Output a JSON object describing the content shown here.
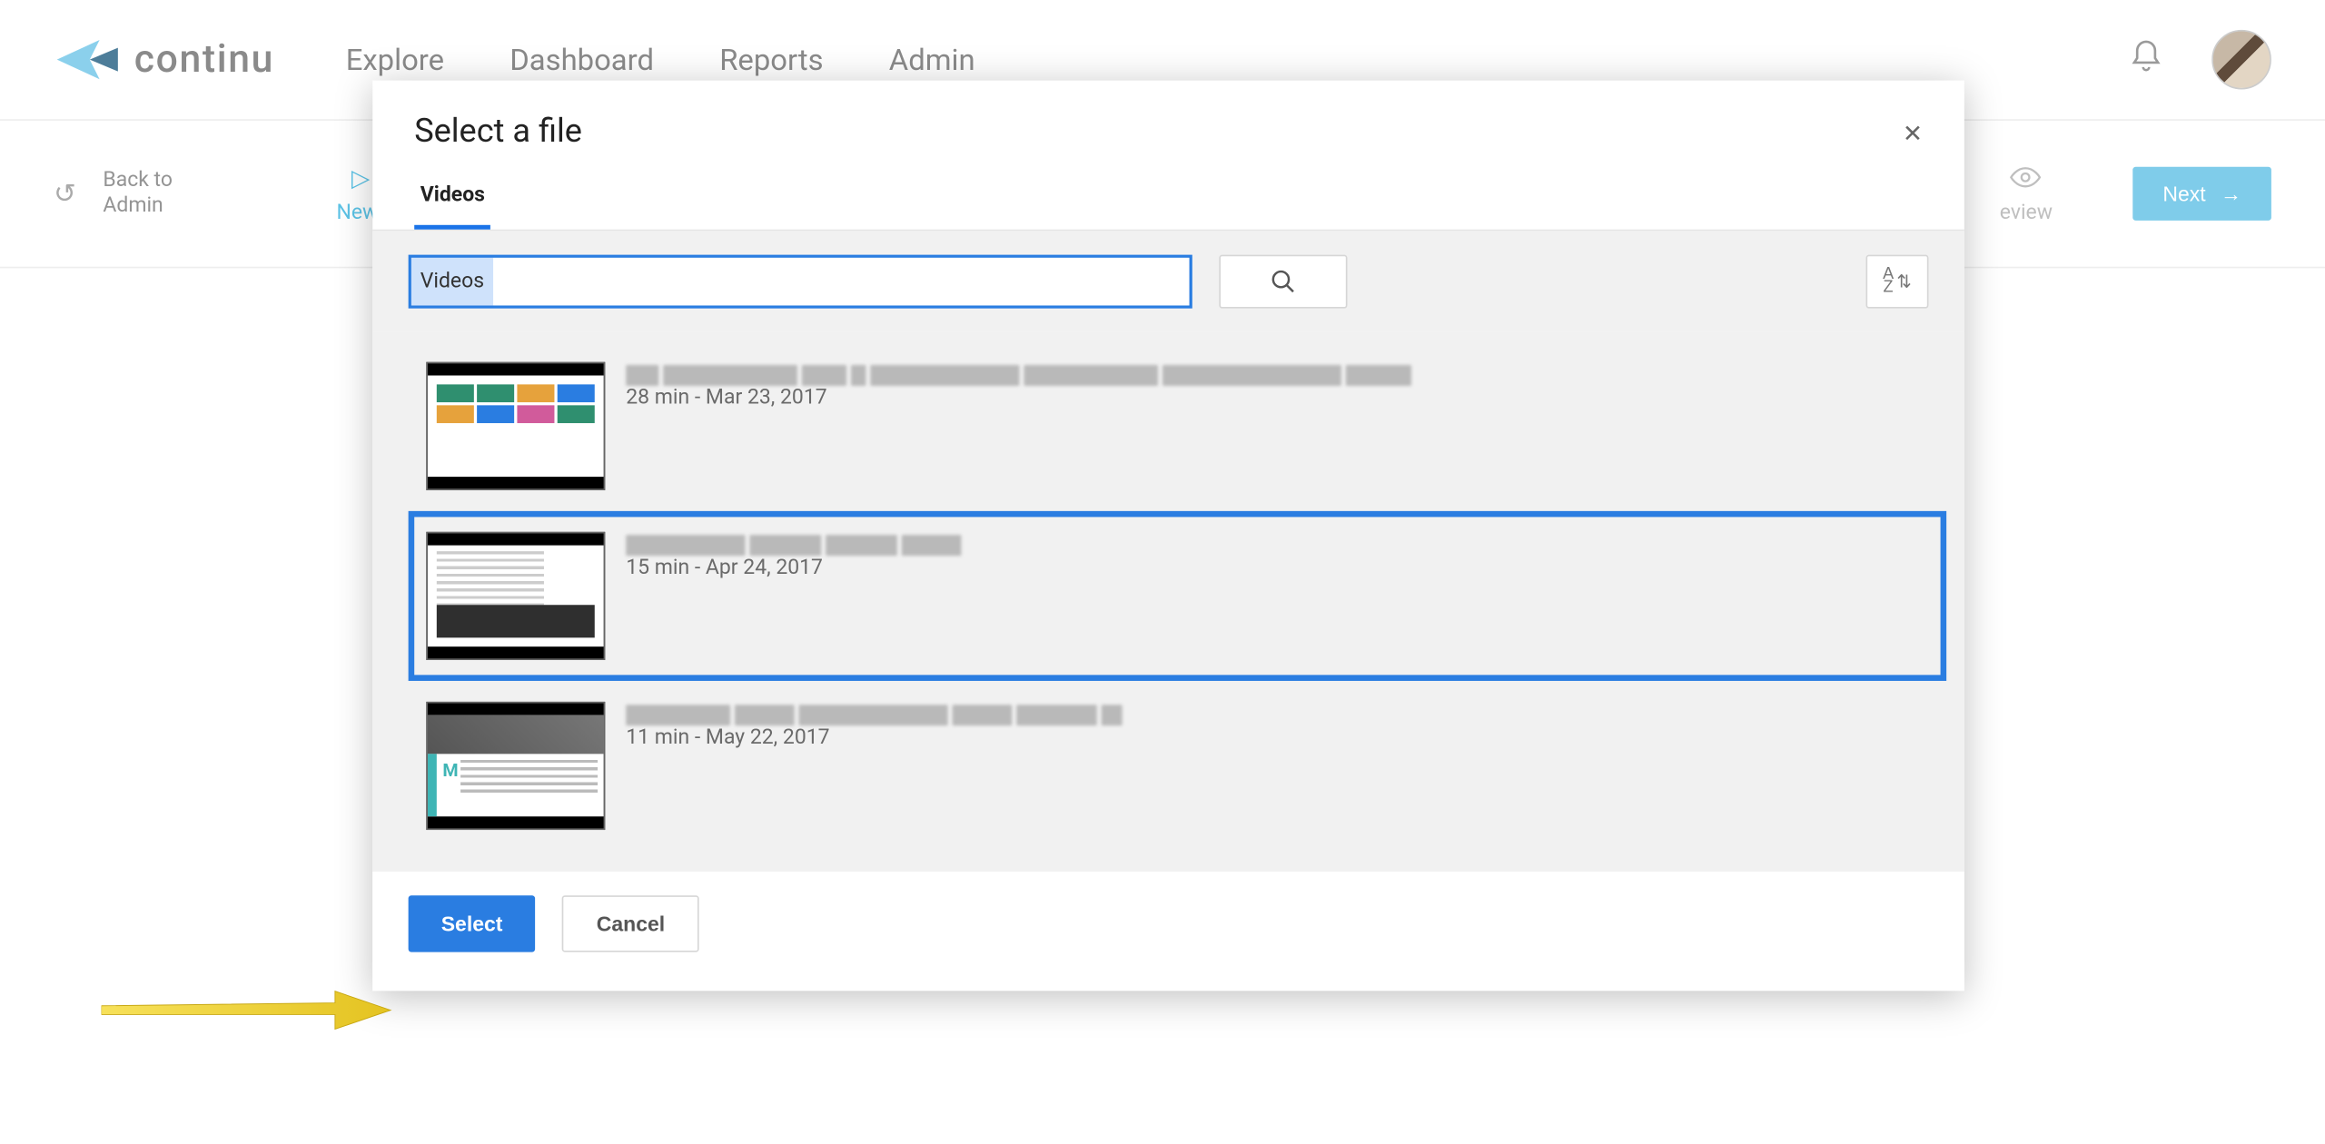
{
  "brand": {
    "name": "continu"
  },
  "nav": {
    "items": [
      "Explore",
      "Dashboard",
      "Reports",
      "Admin"
    ]
  },
  "subbar": {
    "back_label_line1": "Back to",
    "back_label_line2": "Admin",
    "new_video_label": "New Vid",
    "preview_label": "eview",
    "next_label": "Next"
  },
  "modal": {
    "title": "Select a file",
    "tab_label": "Videos",
    "search_value": "Videos",
    "files": [
      {
        "meta": "28 min - Mar 23, 2017",
        "selected": false,
        "title_widths": [
          22,
          90,
          30,
          10,
          100,
          90,
          120,
          44
        ]
      },
      {
        "meta": "15 min - Apr 24, 2017",
        "selected": true,
        "title_widths": [
          80,
          48,
          48,
          40
        ]
      },
      {
        "meta": "11 min - May 22, 2017",
        "selected": false,
        "title_widths": [
          70,
          40,
          100,
          40,
          54,
          14
        ]
      }
    ],
    "select_label": "Select",
    "cancel_label": "Cancel"
  },
  "colors": {
    "accent_blue": "#2a7de1",
    "light_blue": "#7fccea",
    "grid_colors": [
      "#2f8f6f",
      "#2f8f6f",
      "#e6a23c",
      "#2a7de1",
      "#e6a23c",
      "#2a7de1",
      "#d15b9b",
      "#2f8f6f"
    ]
  }
}
